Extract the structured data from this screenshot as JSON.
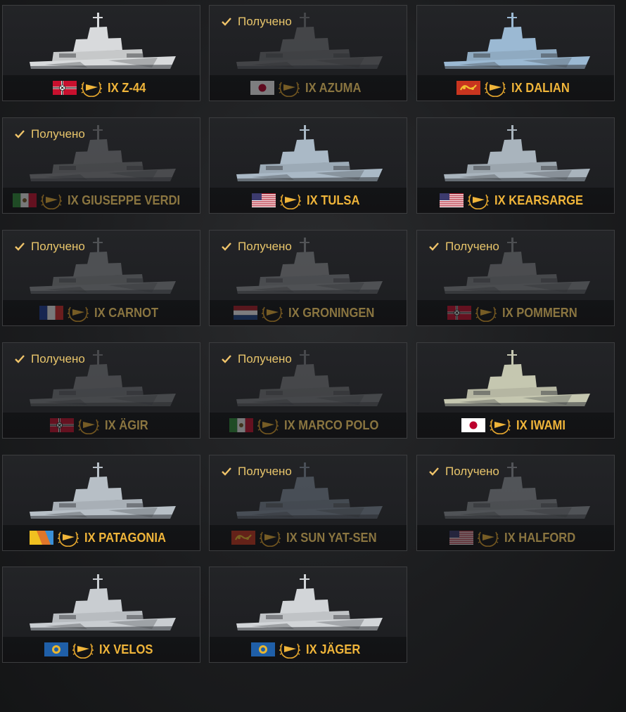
{
  "ships": [
    {
      "tier": "IX",
      "name": "Z-44",
      "owned": false,
      "nation": "germany",
      "hull": "#d8dadc"
    },
    {
      "tier": "IX",
      "name": "AZUMA",
      "owned": true,
      "nation": "japan",
      "hull": "#6f7174"
    },
    {
      "tier": "IX",
      "name": "DALIAN",
      "owned": false,
      "nation": "pan-asia",
      "hull": "#9bb9d3"
    },
    {
      "tier": "IX",
      "name": "GIUSEPPE VERDI",
      "owned": true,
      "nation": "italy",
      "hull": "#7f8184"
    },
    {
      "tier": "IX",
      "name": "TULSA",
      "owned": false,
      "nation": "usa",
      "hull": "#aab9c6"
    },
    {
      "tier": "IX",
      "name": "KEARSARGE",
      "owned": false,
      "nation": "usa",
      "hull": "#a9b4bd"
    },
    {
      "tier": "IX",
      "name": "CARNOT",
      "owned": true,
      "nation": "france",
      "hull": "#86898c"
    },
    {
      "tier": "IX",
      "name": "GRONINGEN",
      "owned": true,
      "nation": "netherlands",
      "hull": "#8a8d90"
    },
    {
      "tier": "IX",
      "name": "POMMERN",
      "owned": true,
      "nation": "germany",
      "hull": "#7f8285"
    },
    {
      "tier": "IX",
      "name": "ÄGIR",
      "owned": true,
      "nation": "germany",
      "hull": "#77797c"
    },
    {
      "tier": "IX",
      "name": "MARCO POLO",
      "owned": true,
      "nation": "italy",
      "hull": "#75777a"
    },
    {
      "tier": "IX",
      "name": "IWAMI",
      "owned": false,
      "nation": "japan",
      "hull": "#c5c7b0"
    },
    {
      "tier": "IX",
      "name": "PATAGONIA",
      "owned": false,
      "nation": "pan-america",
      "hull": "#b7bfc6"
    },
    {
      "tier": "IX",
      "name": "SUN YAT-SEN",
      "owned": true,
      "nation": "pan-asia",
      "hull": "#7a8694"
    },
    {
      "tier": "IX",
      "name": "HALFORD",
      "owned": true,
      "nation": "usa",
      "hull": "#8d9196"
    },
    {
      "tier": "IX",
      "name": "VELOS",
      "owned": false,
      "nation": "europe",
      "hull": "#c9cdd1"
    },
    {
      "tier": "IX",
      "name": "JÄGER",
      "owned": false,
      "nation": "europe",
      "hull": "#d2d5d8"
    }
  ],
  "received_label": "Получено",
  "colors": {
    "accent": "#f0b53a",
    "accent_dim": "#8a7540",
    "received": "#e8c56b"
  }
}
